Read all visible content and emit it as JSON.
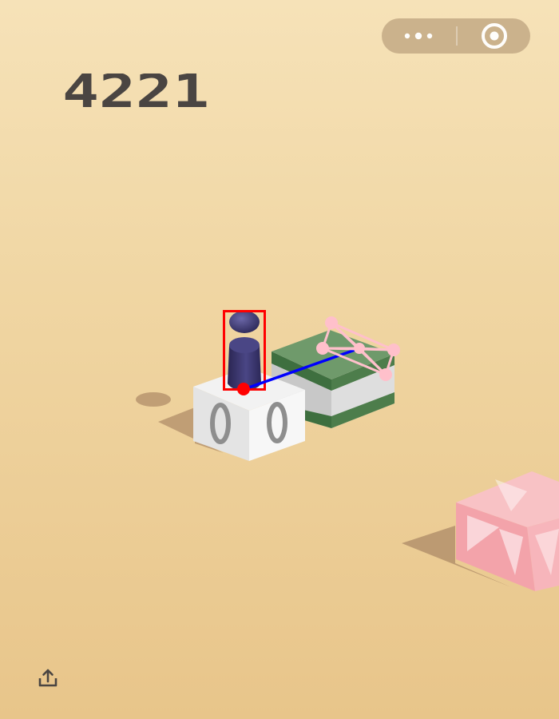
{
  "score": {
    "value": "4221"
  },
  "toolbar": {
    "menu_icon": "more-dots-icon",
    "close_icon": "target-circle-icon"
  },
  "share": {
    "icon": "share-upload-icon"
  },
  "colors": {
    "background_top": "#f6e2b8",
    "background_bottom": "#e8c58a",
    "capsule": "#c9b08a",
    "score": "#4a4542",
    "player": "#3e3a6e",
    "highlight_box": "#ff0000",
    "aim_line": "#0000ff",
    "target_marker": "#ffc0cb",
    "green_block": "#5f8f5e",
    "pink_block": "#f4a7ad"
  }
}
